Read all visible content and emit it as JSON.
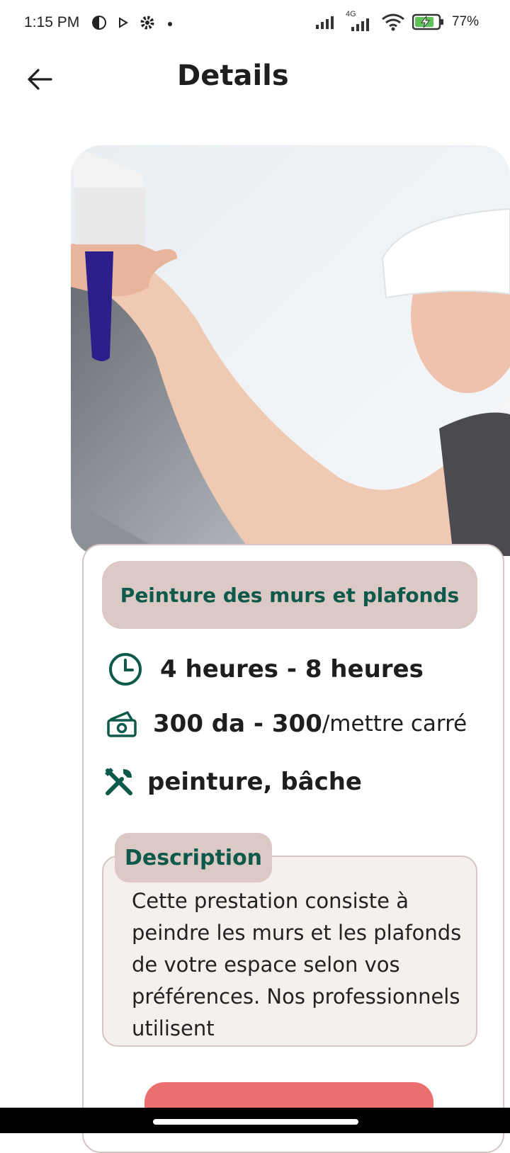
{
  "status_bar": {
    "time": "1:15 PM",
    "network_label": "4G",
    "battery": "77%"
  },
  "header": {
    "title": "Details"
  },
  "service": {
    "title": "Peinture des murs et plafonds",
    "duration": "4 heures - 8 heures",
    "price": "300 da - 300",
    "price_unit": "/mettre carré",
    "materials": "peinture, bâche",
    "description_label": "Description",
    "description": "Cette prestation consiste à peindre les murs et les plafonds de votre espace selon vos préférences. Nos professionnels utilisent"
  },
  "icons": {
    "back": "arrow-left-icon",
    "duration": "clock-icon",
    "price": "money-icon",
    "materials": "tools-icon"
  },
  "colors": {
    "accent_green": "#0e5a4a",
    "chip_bg": "#dcc8c5",
    "button": "#ea6f6f"
  }
}
